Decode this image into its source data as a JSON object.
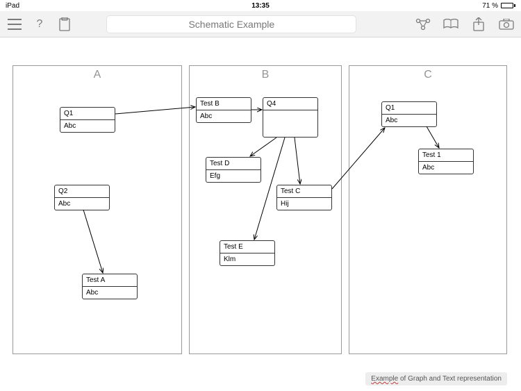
{
  "status": {
    "device": "iPad",
    "time": "13:35",
    "battery_pct": "71 %"
  },
  "toolbar": {
    "title": "Schematic Example"
  },
  "columns": {
    "A": "A",
    "B": "B",
    "C": "C"
  },
  "nodes": {
    "q1a": {
      "title": "Q1",
      "body": "Abc"
    },
    "q2": {
      "title": "Q2",
      "body": "Abc"
    },
    "ta": {
      "title": "Test A",
      "body": "Abc"
    },
    "tb": {
      "title": "Test B",
      "body": "Abc"
    },
    "q4": {
      "title": "Q4",
      "body": ""
    },
    "td": {
      "title": "Test D",
      "body": "Efg"
    },
    "tc": {
      "title": "Test C",
      "body": "Hij"
    },
    "te": {
      "title": "Test E",
      "body": "Klm"
    },
    "q1c": {
      "title": "Q1",
      "body": "Abc"
    },
    "t1": {
      "title": "Test 1",
      "body": "Abc"
    }
  },
  "caption": {
    "word": "Example",
    "rest": " of Graph and Text representation"
  }
}
